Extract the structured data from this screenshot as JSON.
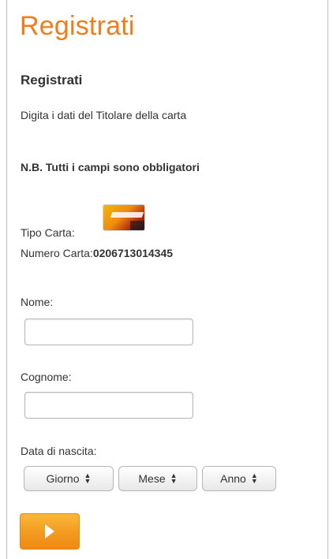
{
  "header": {
    "title": "Registrati"
  },
  "form": {
    "heading": "Registrati",
    "instructions": "Digita i dati del Titolare della carta",
    "note": "N.B. Tutti i campi sono obbligatori",
    "card_type_label": "Tipo Carta:",
    "card_number_label": "Numero Carta:",
    "card_number_value": "0206713014345",
    "name_label": "Nome:",
    "name_value": "",
    "surname_label": "Cognome:",
    "surname_value": "",
    "birthdate_label": "Data di nascita:",
    "day_select": "Giorno",
    "month_select": "Mese",
    "year_select": "Anno",
    "submit_icon": "play-arrow-icon"
  },
  "colors": {
    "title": "#f07d1a",
    "button_top": "#f9b83a",
    "button_bottom": "#ef8914"
  }
}
